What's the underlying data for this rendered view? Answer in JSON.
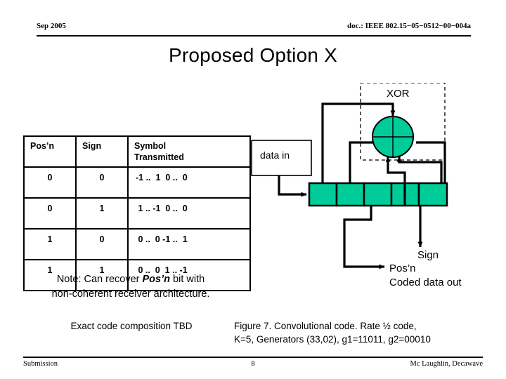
{
  "header": {
    "date": "Sep 2005",
    "doc": "doc.: IEEE 802.15−05−0512−00−004a"
  },
  "title": "Proposed Option X",
  "table": {
    "columns": [
      "Pos’n",
      "Sign",
      "Symbol Transmitted"
    ],
    "column_header_sym_line1": "Symbol",
    "column_header_sym_line2": "Transmitted",
    "rows": [
      {
        "posn": "0",
        "sign": "0",
        "symbol": "-1 ..  1  0 ..  0"
      },
      {
        "posn": "0",
        "sign": "1",
        "symbol": " 1 .. -1  0 ..  0"
      },
      {
        "posn": "1",
        "sign": "0",
        "symbol": " 0 ..  0 -1 ..  1"
      },
      {
        "posn": "1",
        "sign": "1",
        "symbol": " 0 ..  0  1 .. -1"
      }
    ]
  },
  "note": {
    "prefix": "Note: Can recover ",
    "emphasis": "Pos’n",
    "suffix": " bit with",
    "line2": "non-coherent receiver architecture."
  },
  "tbd_note": "Exact code composition TBD",
  "figure_caption": {
    "line1": "Figure 7. Convolutional code. Rate ½ code,",
    "line2": "K=5, Generators (33,02), g1=11011, g2=00010"
  },
  "diagram": {
    "xor_label": "XOR",
    "data_in_label": "data in",
    "sign_label": "Sign",
    "posn_label": "Pos’n",
    "coded_out_label": "Coded data out",
    "register_cells": 5,
    "colors": {
      "cell_fill": "#00CC99",
      "xor_fill": "#00CC99",
      "stroke": "#000000"
    }
  },
  "footer": {
    "left": "Submission",
    "page": "8",
    "right": "Mc Laughlin, Decawave"
  }
}
